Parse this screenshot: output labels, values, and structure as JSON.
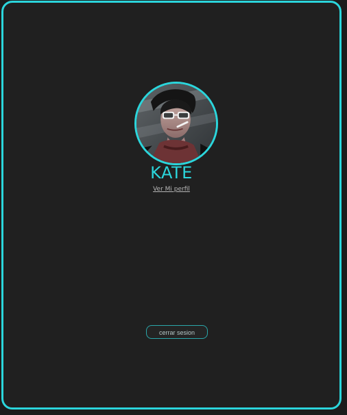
{
  "profile": {
    "name": "KATE",
    "view_profile_label": "Ver Mi perfil",
    "avatar_icon": "avatar-photo"
  },
  "actions": {
    "logout_label": "cerrar sesion"
  },
  "theme": {
    "accent": "#2bd6dc",
    "background": "#202020",
    "muted_text": "#b8b8b8"
  }
}
